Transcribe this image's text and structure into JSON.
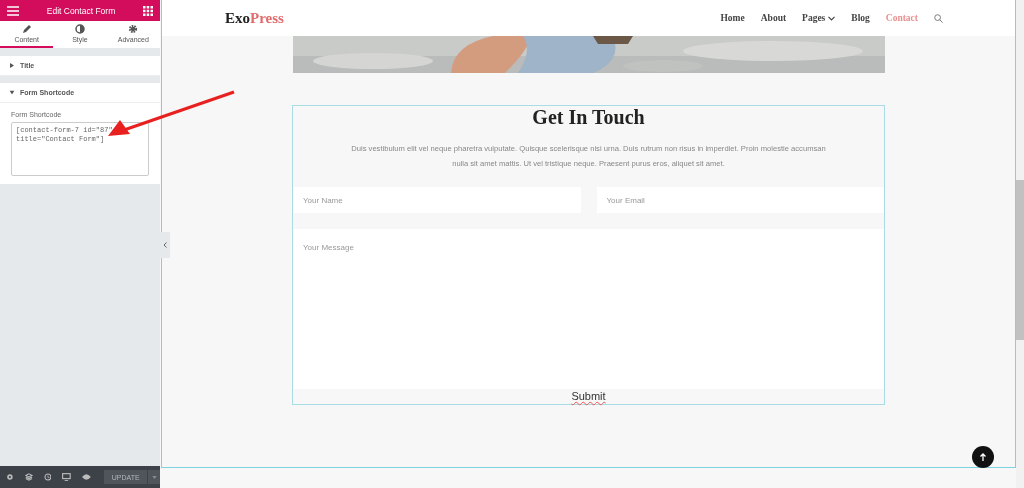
{
  "panel": {
    "title": "Edit Contact Form",
    "tabs": [
      {
        "label": "Content",
        "selected": true
      },
      {
        "label": "Style",
        "selected": false
      },
      {
        "label": "Advanced",
        "selected": false
      }
    ],
    "sections": [
      {
        "title": "Title",
        "expanded": false
      },
      {
        "title": "Form Shortcode",
        "expanded": true,
        "field_label": "Form Shortcode",
        "value": "[contact-form-7 id=\"87\" title=\"Contact Form\"]"
      }
    ],
    "footer": {
      "update": "UPDATE"
    }
  },
  "site": {
    "logo": {
      "first": "Exo",
      "second": "Press"
    },
    "nav": [
      {
        "label": "Home",
        "selected": false,
        "dropdown": false
      },
      {
        "label": "About",
        "selected": false,
        "dropdown": false
      },
      {
        "label": "Pages",
        "selected": false,
        "dropdown": true
      },
      {
        "label": "Blog",
        "selected": false,
        "dropdown": false
      },
      {
        "label": "Contact",
        "selected": true,
        "dropdown": false
      }
    ],
    "contact": {
      "heading": "Get In Touch",
      "text": "Duis vestibulum elit vel neque pharetra vulputate. Quisque scelerisque nisi urna. Duis rutrum non risus in imperdiet. Proin molestie accumsan nulla sit amet mattis. Ut vel tristique neque. Praesent purus eros, aliquet sit amet.",
      "name_placeholder": "Your Name",
      "email_placeholder": "Your Email",
      "message_placeholder": "Your Message",
      "submit": "Submit"
    }
  }
}
